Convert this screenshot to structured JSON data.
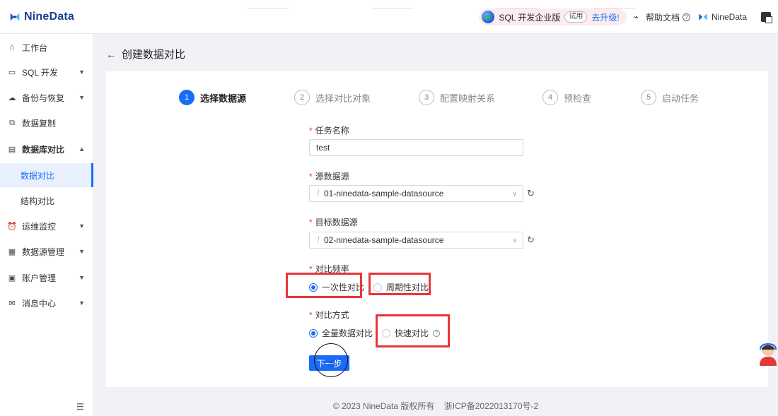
{
  "header": {
    "brand": "NineData",
    "product_label": "SQL 开发企业版",
    "trial_badge": "试用",
    "upgrade_link": "去升级!",
    "help_docs": "帮助文档",
    "user_name": "NineData"
  },
  "sidebar": {
    "items": [
      {
        "label": "工作台",
        "icon": "home-icon"
      },
      {
        "label": "SQL 开发",
        "icon": "monitor-icon"
      },
      {
        "label": "备份与恢复",
        "icon": "cloud-icon"
      },
      {
        "label": "数据复制",
        "icon": "copy-icon"
      },
      {
        "label": "数据库对比",
        "icon": "database-icon"
      },
      {
        "label": "数据对比",
        "icon": ""
      },
      {
        "label": "结构对比",
        "icon": ""
      },
      {
        "label": "运维监控",
        "icon": "alarm-icon"
      },
      {
        "label": "数据源管理",
        "icon": "datasource-icon"
      },
      {
        "label": "账户管理",
        "icon": "account-icon"
      },
      {
        "label": "消息中心",
        "icon": "mail-icon"
      }
    ]
  },
  "page": {
    "title": "创建数据对比"
  },
  "steps": [
    {
      "num": "1",
      "label": "选择数据源"
    },
    {
      "num": "2",
      "label": "选择对比对象"
    },
    {
      "num": "3",
      "label": "配置映射关系"
    },
    {
      "num": "4",
      "label": "预检查"
    },
    {
      "num": "5",
      "label": "启动任务"
    }
  ],
  "form": {
    "required_mark": "*",
    "task_name_label": "任务名称",
    "task_name_value": "test",
    "source_label": "源数据源",
    "source_value": "01-ninedata-sample-datasource",
    "target_label": "目标数据源",
    "target_value": "02-ninedata-sample-datasource",
    "frequency_label": "对比频率",
    "frequency_options": [
      "一次性对比",
      "周期性对比"
    ],
    "frequency_selected": "一次性对比",
    "method_label": "对比方式",
    "method_options": [
      "全量数据对比",
      "快速对比"
    ],
    "method_selected": "全量数据对比",
    "next_button": "下一步"
  },
  "footer": {
    "copyright": "© 2023 NineData 版权所有",
    "icp": "浙ICP备2022013170号-2"
  },
  "colors": {
    "accent": "#1a6cf6",
    "highlight_box": "#e8353b"
  }
}
